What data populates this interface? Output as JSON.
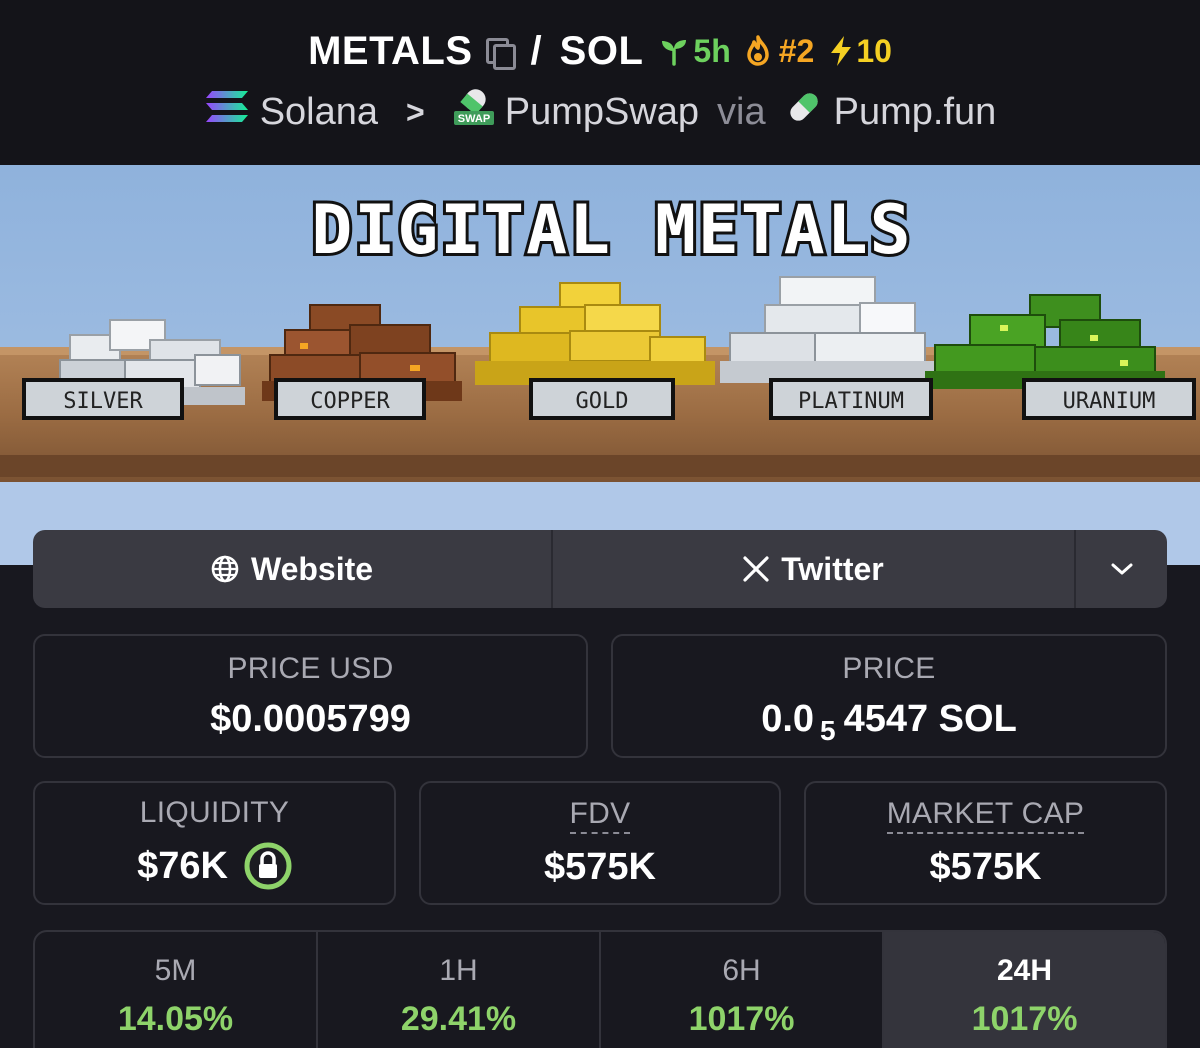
{
  "header": {
    "base_symbol": "METALS",
    "separator": "/",
    "quote_symbol": "SOL",
    "age": "5h",
    "rank": "#2",
    "boosts": "10",
    "chain": "Solana",
    "dex": "PumpSwap",
    "via": "via",
    "launchpad": "Pump.fun"
  },
  "banner": {
    "title": "DIGITAL METALS",
    "labels": [
      "SILVER",
      "COPPER",
      "GOLD",
      "PLATINUM",
      "URANIUM"
    ]
  },
  "links": {
    "website": "Website",
    "twitter": "Twitter"
  },
  "stats": {
    "price_usd_label": "PRICE USD",
    "price_usd": "$0.0005799",
    "price_label": "PRICE",
    "price_prefix": "0.0",
    "price_zeros": "5",
    "price_digits": "4547 SOL",
    "liquidity_label": "LIQUIDITY",
    "liquidity": "$76K",
    "fdv_label": "FDV",
    "fdv": "$575K",
    "mcap_label": "MARKET CAP",
    "mcap": "$575K"
  },
  "timeframes": [
    {
      "label": "5M",
      "value": "14.05%"
    },
    {
      "label": "1H",
      "value": "29.41%"
    },
    {
      "label": "6H",
      "value": "1017%"
    },
    {
      "label": "24H",
      "value": "1017%"
    }
  ],
  "colors": {
    "background": "#18181f",
    "positive": "#8ed36a",
    "age": "#6dd15e",
    "rank": "#f5a623",
    "boost": "#f5d023"
  }
}
